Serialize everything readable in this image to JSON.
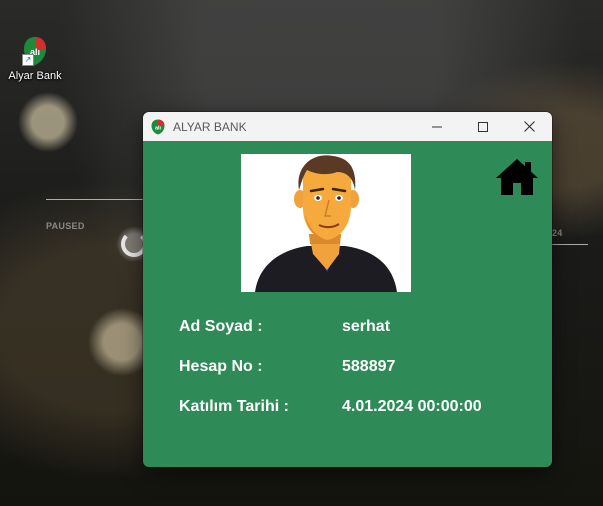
{
  "desktop": {
    "shortcut_label": "Alyar Bank",
    "overlay_left_text": "PAUSED",
    "overlay_right_text": "24"
  },
  "window": {
    "title": "ALYAR BANK",
    "accent_color": "#2e8b57",
    "controls": [
      "minimize-icon",
      "maximize-icon",
      "close-icon"
    ]
  },
  "profile": {
    "fields": [
      {
        "label": "Ad Soyad :",
        "value": "serhat"
      },
      {
        "label": "Hesap No :",
        "value": "588897"
      },
      {
        "label": "Katılım Tarihi :",
        "value": "4.01.2024 00:00:00"
      }
    ]
  }
}
